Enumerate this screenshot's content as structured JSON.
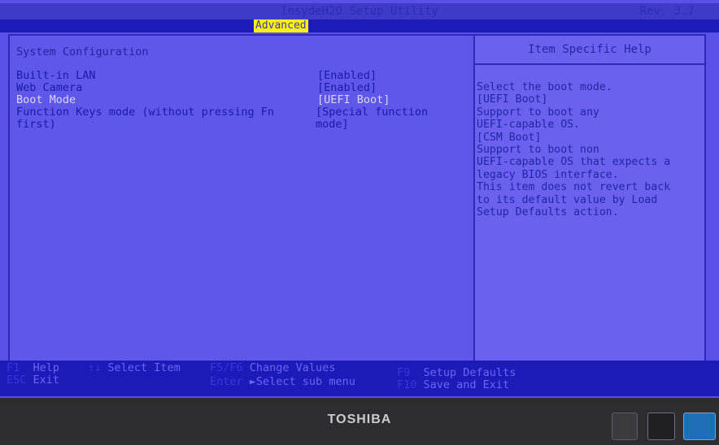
{
  "title": "InsydeH2O Setup Utility",
  "revision": "Rev. 3.7",
  "active_tab": "Advanced",
  "section_title": "System Configuration",
  "items": [
    {
      "label": "Built-in LAN",
      "value": "[Enabled]"
    },
    {
      "label": "Web Camera",
      "value": "[Enabled]"
    },
    {
      "label": "Boot Mode",
      "value": "[UEFI Boot]"
    },
    {
      "label": "Function Keys mode (without pressing Fn\nfirst)",
      "value": "[Special function\nmode]"
    }
  ],
  "help": {
    "header": "Item Specific Help",
    "text": "Select the boot mode.\n[UEFI Boot]\nSupport to boot any\nUEFI-capable OS.\n[CSM Boot]\nSupport to boot non\nUEFI-capable OS that expects a\nlegacy BIOS interface.\nThis item does not revert back\nto its default value by Load\nSetup Defaults action."
  },
  "footer": {
    "f1_key": "F1",
    "f1_desc": "Help",
    "esc_key": "ESC",
    "esc_desc": "Exit",
    "arrows_key": "↑↓",
    "arrows_desc": "Select Item",
    "f5f6_key": "F5/F6",
    "f5f6_desc": "Change Values",
    "enter_key": "Enter",
    "enter_desc": "►Select sub menu",
    "f9_key": "F9",
    "f9_desc": "Setup Defaults",
    "f10_key": "F10",
    "f10_desc": "Save and Exit"
  },
  "brand": "TOSHIBA"
}
